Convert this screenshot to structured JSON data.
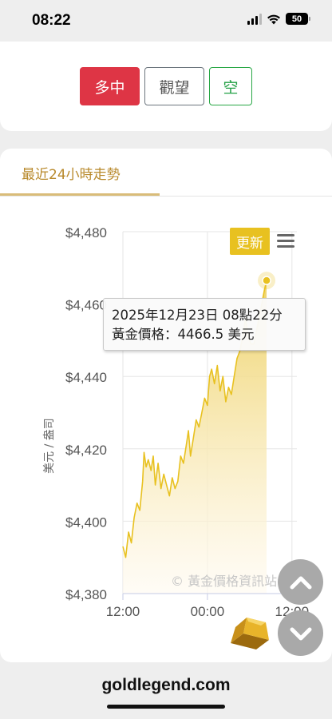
{
  "status": {
    "time": "08:22",
    "battery": "50"
  },
  "vote": {
    "long_label": "多中",
    "watch_label": "觀望",
    "short_label": "空"
  },
  "tab": {
    "title": "最近24小時走勢"
  },
  "toolbar": {
    "refresh_label": "更新"
  },
  "tooltip": {
    "date": "2025年12月23日 08點22分",
    "price": "黃金價格：4466.5 美元"
  },
  "watermark": "© 黃金價格資訊站",
  "footer": {
    "site": "goldlegend.com"
  },
  "colors": {
    "line": "#e8c120",
    "area_top": "#efd36a",
    "area_bottom": "#fffaf0",
    "long": "#de3545",
    "short": "#28a745",
    "tab_accent": "#b8892b"
  },
  "chart_data": {
    "type": "area",
    "ylabel": "美元 / 盎司",
    "ylim": [
      4380,
      4480
    ],
    "yticks": [
      "$4,380",
      "$4,400",
      "$4,420",
      "$4,440",
      "$4,460",
      "$4,480"
    ],
    "xticks": [
      "12:00",
      "00:00",
      "12:00"
    ],
    "x_tick_hours": [
      0,
      12,
      24
    ],
    "x_range_hours": [
      0,
      24.7
    ],
    "last_point_hours": 20.4,
    "series": [
      {
        "points": [
          [
            0.0,
            4393
          ],
          [
            0.4,
            4390
          ],
          [
            0.8,
            4397
          ],
          [
            1.2,
            4394
          ],
          [
            1.6,
            4401
          ],
          [
            2.0,
            4405
          ],
          [
            2.4,
            4403
          ],
          [
            2.8,
            4411
          ],
          [
            3.0,
            4419
          ],
          [
            3.3,
            4415
          ],
          [
            3.6,
            4417
          ],
          [
            4.0,
            4414
          ],
          [
            4.3,
            4418
          ],
          [
            4.6,
            4410
          ],
          [
            5.0,
            4416
          ],
          [
            5.4,
            4409
          ],
          [
            5.8,
            4413
          ],
          [
            6.2,
            4410
          ],
          [
            6.6,
            4407
          ],
          [
            7.0,
            4412
          ],
          [
            7.4,
            4409
          ],
          [
            7.8,
            4411
          ],
          [
            8.2,
            4418
          ],
          [
            8.6,
            4416
          ],
          [
            9.0,
            4421
          ],
          [
            9.3,
            4425
          ],
          [
            9.6,
            4418
          ],
          [
            10.0,
            4423
          ],
          [
            10.4,
            4428
          ],
          [
            10.8,
            4426
          ],
          [
            11.2,
            4430
          ],
          [
            11.6,
            4434
          ],
          [
            12.0,
            4432
          ],
          [
            12.3,
            4440
          ],
          [
            12.6,
            4442
          ],
          [
            13.0,
            4438
          ],
          [
            13.4,
            4443
          ],
          [
            13.8,
            4436
          ],
          [
            14.2,
            4440
          ],
          [
            14.6,
            4433
          ],
          [
            15.0,
            4437
          ],
          [
            15.4,
            4435
          ],
          [
            15.8,
            4440
          ],
          [
            16.2,
            4445
          ],
          [
            16.6,
            4447
          ],
          [
            17.0,
            4451
          ],
          [
            17.4,
            4456
          ],
          [
            17.8,
            4451
          ],
          [
            18.2,
            4449
          ],
          [
            18.6,
            4449
          ],
          [
            19.0,
            4453
          ],
          [
            19.4,
            4457
          ],
          [
            19.8,
            4461
          ],
          [
            20.1,
            4464
          ],
          [
            20.4,
            4466.5
          ]
        ]
      }
    ],
    "tooltip_point": {
      "x_hours": 20.4,
      "y": 4466.5
    },
    "grid": true
  }
}
